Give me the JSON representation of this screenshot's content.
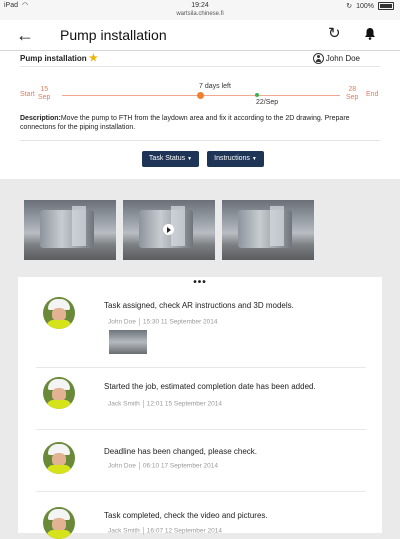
{
  "status_bar": {
    "carrier": "iPad",
    "wifi_icon": "wifi-icon",
    "time": "19:24",
    "url": "wartsila.chinese.fi",
    "battery_label": "100%"
  },
  "header": {
    "title": "Pump installation",
    "back_icon": "back-arrow-icon",
    "refresh_icon": "refresh-icon",
    "bell_icon": "bell-icon"
  },
  "task": {
    "name": "Pump installation",
    "favorite_icon": "star-icon",
    "assignee": "John Doe",
    "timeline": {
      "start_label": "Start",
      "start_day": "15",
      "start_month": "Sep",
      "end_label": "End",
      "end_day": "28",
      "end_month": "Sep",
      "days_left": "7 days left",
      "due_date": "22/Sep"
    },
    "description_label": "Description:",
    "description": "Move the pump to FTH from the laydown area and fix it according to the 2D drawing. Prepare connectons for the piping installation."
  },
  "buttons": {
    "task_status": "Task Status",
    "instructions": "Instructions"
  },
  "media": [
    {
      "type": "image"
    },
    {
      "type": "video"
    },
    {
      "type": "image"
    }
  ],
  "feed": {
    "more_label": "•••",
    "entries": [
      {
        "message": "Task assigned, check AR instructions and 3D models.",
        "author": "John Doe",
        "timestamp": "15:30 11 September 2014",
        "has_attachment": true
      },
      {
        "message": "Started the job, estimated completion date has been added.",
        "author": "Jack Smith",
        "timestamp": "12:01 15 September 2014",
        "has_attachment": false
      },
      {
        "message": "Deadline has been changed, please check.",
        "author": "John Doe",
        "timestamp": "06:10 17 September 2014",
        "has_attachment": false
      },
      {
        "message": "Task completed, check the video and pictures.",
        "author": "Jack Smith",
        "timestamp": "16:07 12 September 2014",
        "has_attachment": false
      }
    ]
  },
  "colors": {
    "header_bg": "#ffffff",
    "button_bg": "#1e3557",
    "timeline_accent": "#e07c5a",
    "progress_dot": "#f08030",
    "due_dot": "#3cb44b",
    "favorite_star": "#f0b400"
  }
}
